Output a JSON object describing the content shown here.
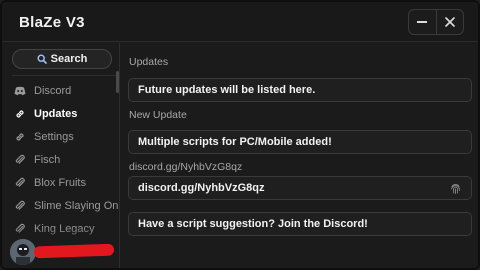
{
  "window": {
    "title": "BlaZe V3"
  },
  "titlebar": {
    "minimize_icon": "minimize-icon",
    "close_icon": "close-icon"
  },
  "sidebar": {
    "search_label": "Search",
    "items": [
      {
        "label": "Discord",
        "icon": "discord-icon",
        "active": false
      },
      {
        "label": "Updates",
        "icon": "link-icon",
        "active": true
      },
      {
        "label": "Settings",
        "icon": "link-icon",
        "active": false
      },
      {
        "label": "Fisch",
        "icon": "paperclip-icon",
        "active": false
      },
      {
        "label": "Blox Fruits",
        "icon": "paperclip-icon",
        "active": false
      },
      {
        "label": "Slime Slaying Online",
        "icon": "paperclip-icon",
        "active": false
      },
      {
        "label": "King Legacy",
        "icon": "paperclip-icon",
        "active": false
      }
    ]
  },
  "main": {
    "updates_label": "Updates",
    "updates_text": "Future updates will be listed here.",
    "new_update_label": "New Update",
    "new_update_text": "Multiple scripts for PC/Mobile added!",
    "discord_label": "discord.gg/NyhbVzG8qz",
    "discord_text": "discord.gg/NyhbVzG8qz",
    "suggestion_text": "Have a script suggestion? Join the Discord!"
  }
}
